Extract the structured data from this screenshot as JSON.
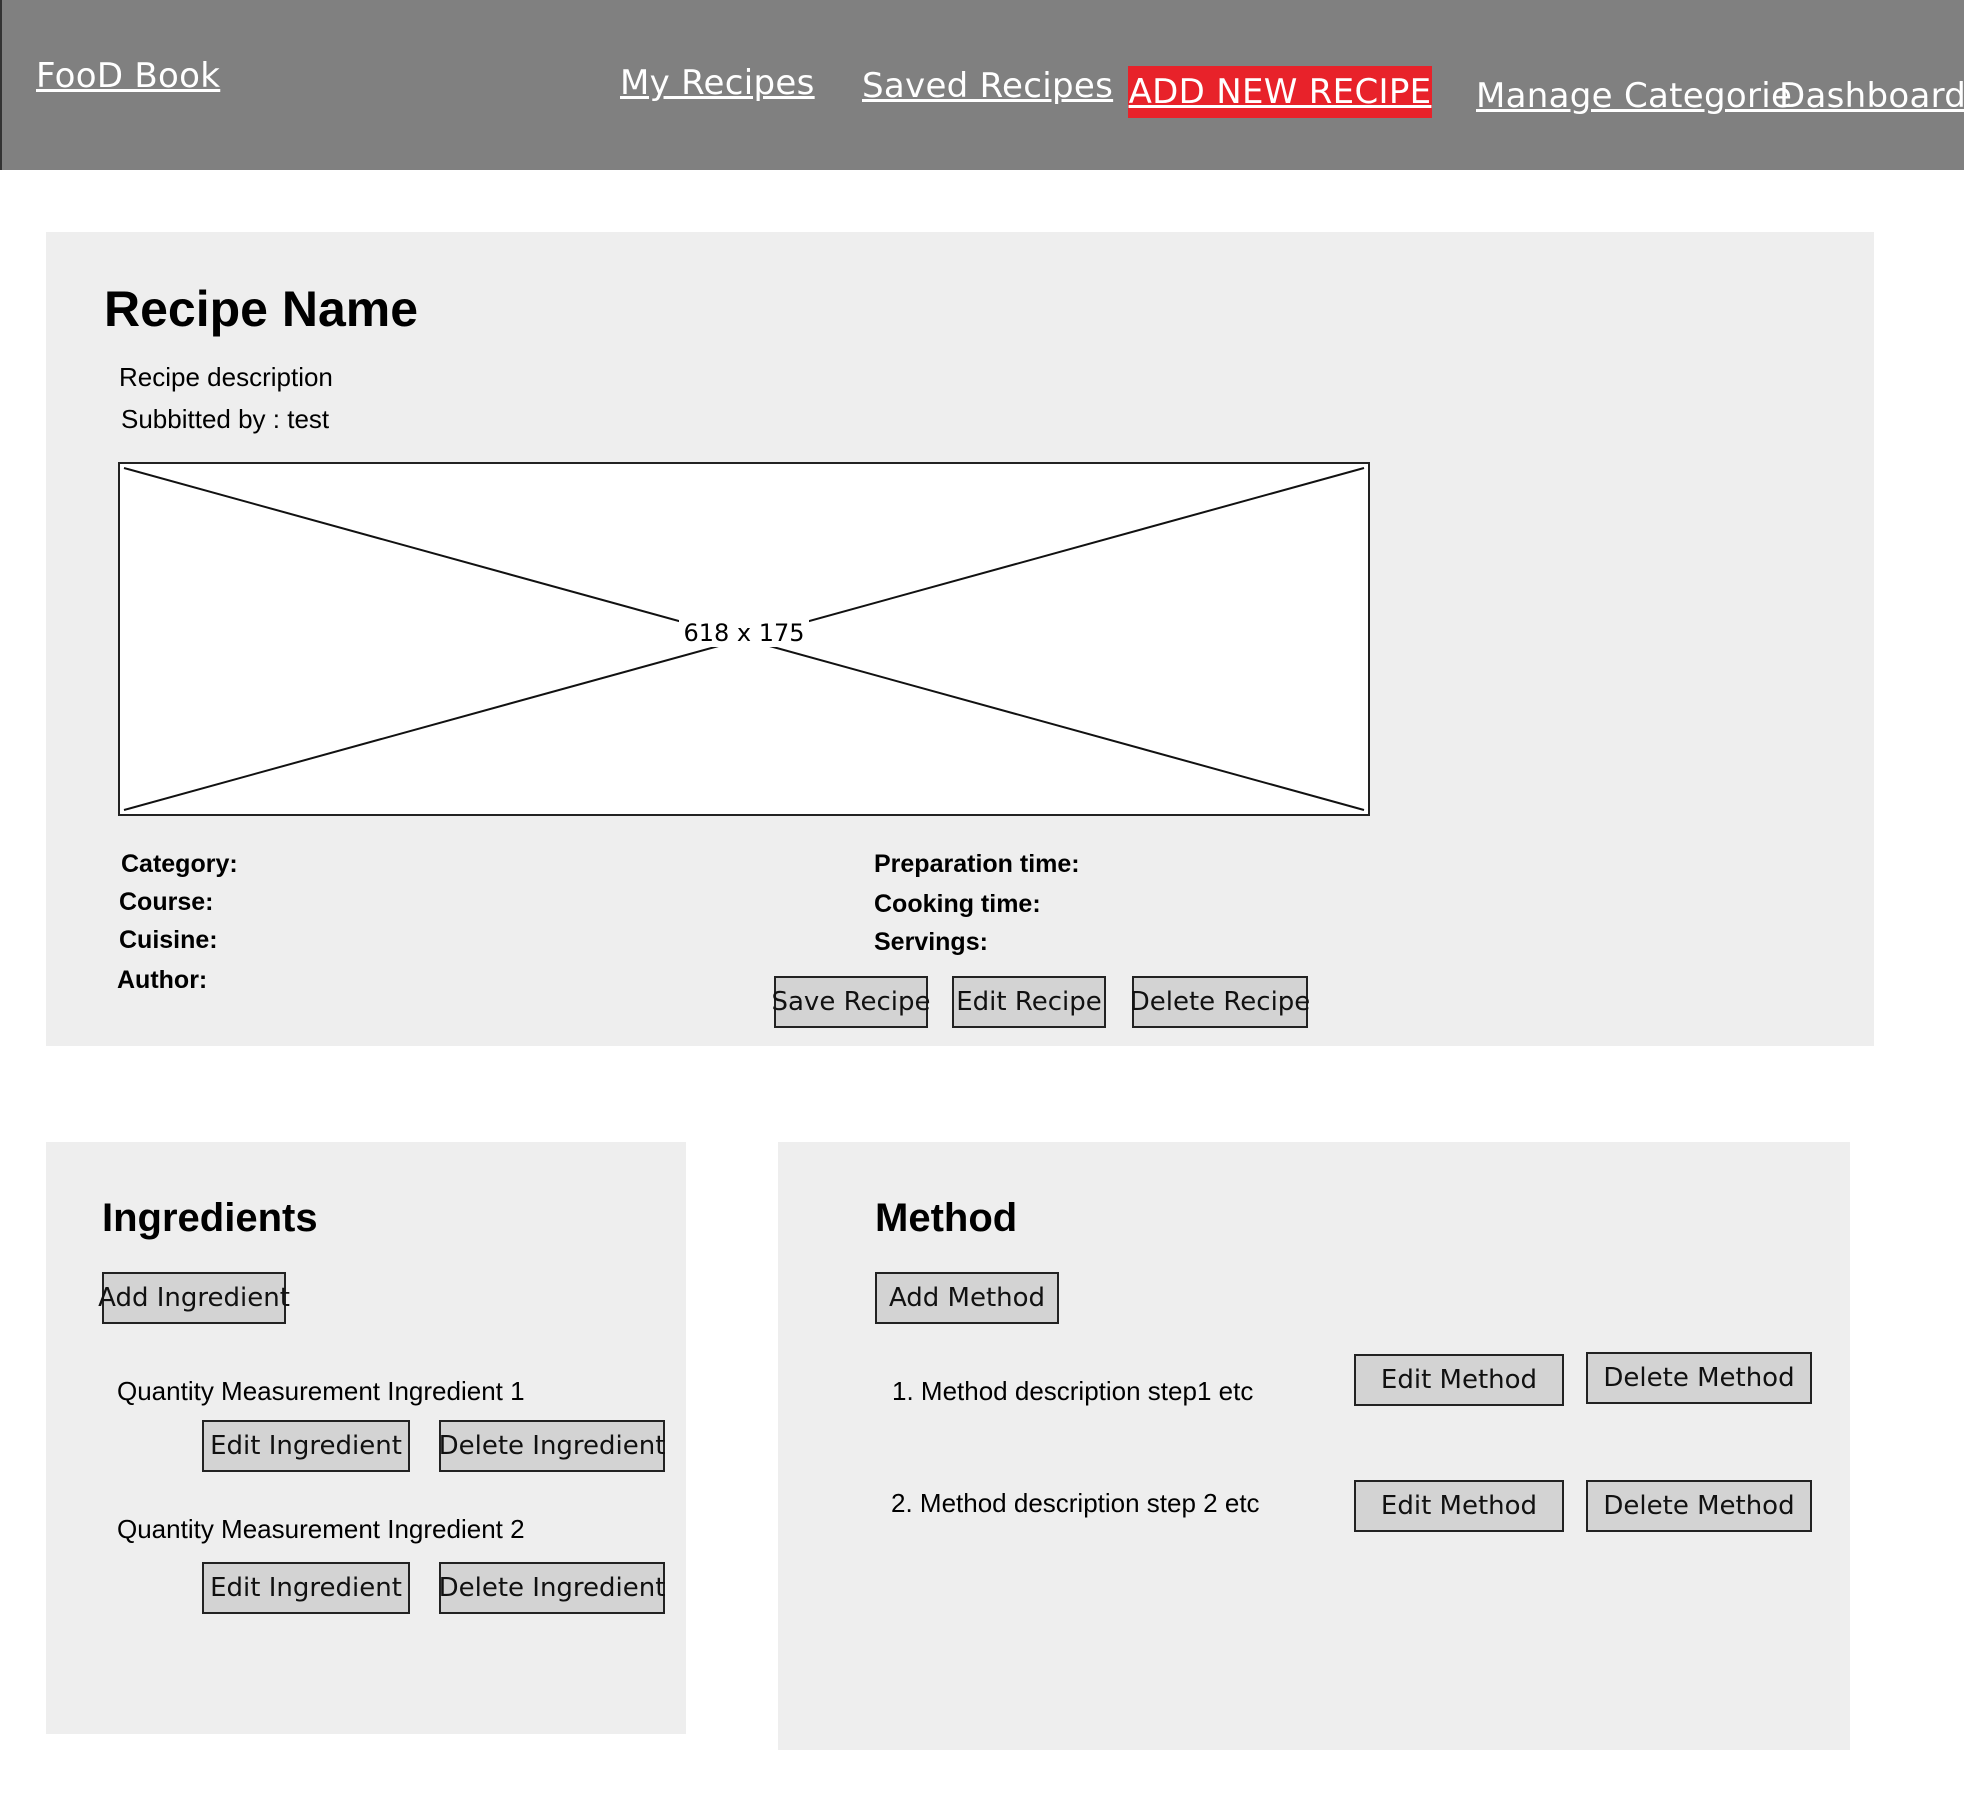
{
  "nav": {
    "brand": "FooD Book",
    "my_recipes": "My Recipes",
    "saved_recipes": "Saved Recipes",
    "add_new_recipe": "ADD NEW RECIPE",
    "manage_categories": "Manage Categorie",
    "dashboard": "Dashboard",
    "add_color": "#e8222a"
  },
  "recipe": {
    "name": "Recipe Name",
    "description": "Recipe description",
    "submitted_by": "Subbitted by : test",
    "image_placeholder": "618 x 175",
    "labels": {
      "category": "Category:",
      "course": "Course:",
      "cuisine": "Cuisine:",
      "author": "Author:",
      "prep_time": "Preparation time:",
      "cook_time": "Cooking time:",
      "servings": "Servings:"
    },
    "buttons": {
      "save": "Save Recipe",
      "edit": "Edit Recipe",
      "delete": "Delete Recipe"
    }
  },
  "ingredients": {
    "title": "Ingredients",
    "add_button": "Add Ingredient",
    "items": [
      {
        "text": "Quantity Measurement Ingredient 1",
        "edit": "Edit Ingredient",
        "delete": "Delete Ingredient"
      },
      {
        "text": "Quantity Measurement Ingredient 2",
        "edit": "Edit Ingredient",
        "delete": "Delete Ingredient"
      }
    ]
  },
  "method": {
    "title": "Method",
    "add_button": "Add Method",
    "steps": [
      {
        "text": "1. Method description step1 etc",
        "edit": "Edit Method",
        "delete": "Delete Method"
      },
      {
        "text": "2. Method description step 2 etc",
        "edit": "Edit Method",
        "delete": "Delete Method"
      }
    ]
  }
}
